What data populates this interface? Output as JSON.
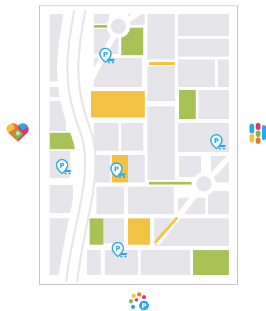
{
  "map": {
    "parking_marker_count": 5,
    "colors": {
      "block": "#e5e5ea",
      "road": "#ffffff",
      "frame_border": "#b9b9bb",
      "park": "#a8c255",
      "highlight": "#f4c242",
      "marker": "#2ba8e0"
    }
  },
  "markers": [
    {
      "name": "parking-marker-1",
      "icon": "parking-icon"
    },
    {
      "name": "parking-marker-2",
      "icon": "parking-icon"
    },
    {
      "name": "parking-marker-3",
      "icon": "parking-icon"
    },
    {
      "name": "parking-marker-4",
      "icon": "parking-icon"
    },
    {
      "name": "parking-marker-5",
      "icon": "parking-icon"
    }
  ],
  "logos": {
    "left": {
      "icon": "puzzle-heart-icon"
    },
    "right": {
      "icon": "colorful-letters-icon"
    },
    "bottom": {
      "icon": "dots-parking-icon"
    }
  }
}
